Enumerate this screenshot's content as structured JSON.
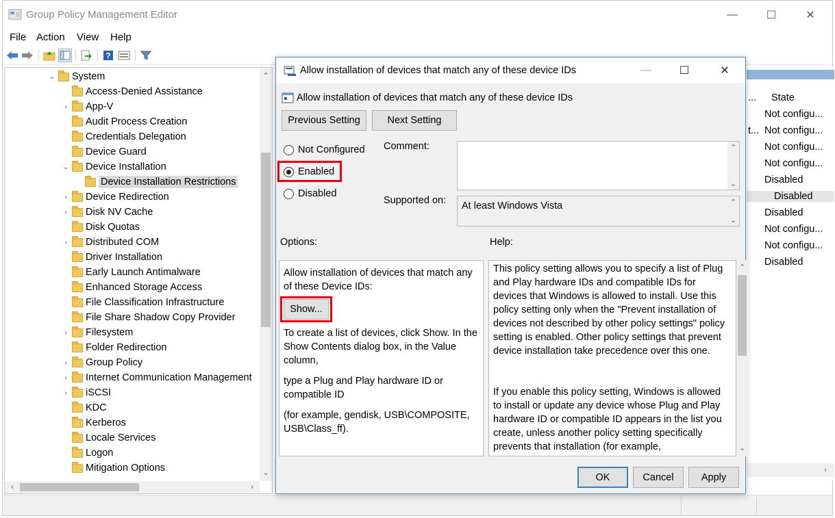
{
  "window": {
    "title": "Group Policy Management Editor",
    "controls": {
      "minimize": "—",
      "maximize": "☐",
      "close": "✕"
    }
  },
  "menu": [
    "File",
    "Action",
    "View",
    "Help"
  ],
  "toolbar_icons": [
    "back-icon",
    "forward-icon",
    "up-folder-icon",
    "show-hide-tree-icon",
    "export-icon",
    "help-icon",
    "properties-icon",
    "filter-icon"
  ],
  "tree": {
    "root": "System",
    "items": [
      {
        "label": "Access-Denied Assistance",
        "expander": ""
      },
      {
        "label": "App-V",
        "expander": "›"
      },
      {
        "label": "Audit Process Creation",
        "expander": ""
      },
      {
        "label": "Credentials Delegation",
        "expander": ""
      },
      {
        "label": "Device Guard",
        "expander": ""
      },
      {
        "label": "Device Installation",
        "expander": "⌄"
      },
      {
        "label": "Device Installation Restrictions",
        "expander": "",
        "child": true,
        "selected": true
      },
      {
        "label": "Device Redirection",
        "expander": "›"
      },
      {
        "label": "Disk NV Cache",
        "expander": "›"
      },
      {
        "label": "Disk Quotas",
        "expander": ""
      },
      {
        "label": "Distributed COM",
        "expander": "›"
      },
      {
        "label": "Driver Installation",
        "expander": ""
      },
      {
        "label": "Early Launch Antimalware",
        "expander": ""
      },
      {
        "label": "Enhanced Storage Access",
        "expander": ""
      },
      {
        "label": "File Classification Infrastructure",
        "expander": ""
      },
      {
        "label": "File Share Shadow Copy Provider",
        "expander": ""
      },
      {
        "label": "Filesystem",
        "expander": "›"
      },
      {
        "label": "Folder Redirection",
        "expander": ""
      },
      {
        "label": "Group Policy",
        "expander": "›"
      },
      {
        "label": "Internet Communication Management",
        "expander": "›"
      },
      {
        "label": "iSCSI",
        "expander": "›"
      },
      {
        "label": "KDC",
        "expander": ""
      },
      {
        "label": "Kerberos",
        "expander": ""
      },
      {
        "label": "Locale Services",
        "expander": ""
      },
      {
        "label": "Logon",
        "expander": ""
      },
      {
        "label": "Mitigation Options",
        "expander": ""
      }
    ]
  },
  "state_column": {
    "header": "State",
    "values": [
      "Not configu...",
      "Not configu...",
      "Not configu...",
      "Not configu...",
      "Disabled",
      "Disabled",
      "Disabled",
      "Not configu...",
      "Not configu...",
      "Disabled"
    ],
    "truncation_marks": [
      "...",
      "t...",
      "",
      ""
    ]
  },
  "dialog": {
    "title": "Allow installation of devices that match any of these device IDs",
    "heading": "Allow installation of devices that match any of these device IDs",
    "previous_setting": "Previous Setting",
    "next_setting": "Next Setting",
    "radio": {
      "not_configured": "Not Configured",
      "enabled": "Enabled",
      "disabled": "Disabled"
    },
    "selected_radio": "Enabled",
    "comment_label": "Comment:",
    "supported_on_label": "Supported on:",
    "supported_on_value": "At least Windows Vista",
    "options_label": "Options:",
    "help_label": "Help:",
    "options": {
      "intro": "Allow installation of devices that match any of these Device IDs:",
      "show_button": "Show...",
      "p1": "To create a list of devices, click Show. In the Show Contents dialog box, in the Value column,",
      "p2": "type a Plug and Play hardware ID or compatible ID",
      "p3": "(for example, gendisk, USB\\COMPOSITE, USB\\Class_ff)."
    },
    "help": {
      "p1": "This policy setting allows you to specify a list of Plug and Play hardware IDs and compatible IDs for devices that Windows is allowed to install. Use this policy setting only when the \"Prevent installation of devices not described by other policy settings\" policy setting is enabled. Other policy settings that prevent device installation take precedence over this one.",
      "p2": "If you enable this policy setting, Windows is allowed to install or update any device whose Plug and Play hardware ID or compatible ID appears in the list you create, unless another policy setting specifically prevents that installation (for example,"
    },
    "ok": "OK",
    "cancel": "Cancel",
    "apply": "Apply"
  },
  "colors": {
    "highlight": "#e60012",
    "accent": "#3c7fb1",
    "folder": "#f0c85a"
  }
}
